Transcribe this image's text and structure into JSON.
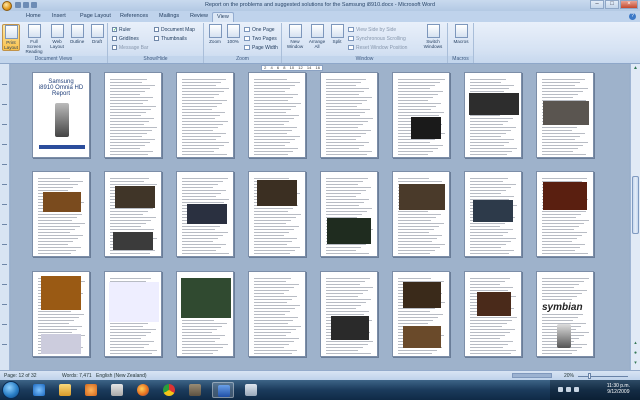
{
  "window": {
    "title": "Report on the problems and suggested solutions for the Samsung i8910.docx - Microsoft Word"
  },
  "tabs": [
    "Home",
    "Insert",
    "Page Layout",
    "References",
    "Mailings",
    "Review",
    "View"
  ],
  "active_tab": "View",
  "ribbon": {
    "document_views": {
      "label": "Document Views",
      "buttons": [
        "Print Layout",
        "Full Screen Reading",
        "Web Layout",
        "Outline",
        "Draft"
      ]
    },
    "show_hide": {
      "label": "Show/Hide",
      "checks": [
        {
          "label": "Ruler",
          "checked": true
        },
        {
          "label": "Gridlines",
          "checked": false
        },
        {
          "label": "Message Bar",
          "checked": false
        },
        {
          "label": "Document Map",
          "checked": false
        },
        {
          "label": "Thumbnails",
          "checked": false
        }
      ]
    },
    "zoom": {
      "label": "Zoom",
      "buttons": [
        "Zoom",
        "100%"
      ],
      "small": [
        "One Page",
        "Two Pages",
        "Page Width"
      ]
    },
    "window": {
      "label": "Window",
      "buttons": [
        "New Window",
        "Arrange All",
        "Split"
      ],
      "small": [
        "View Side by Side",
        "Synchronous Scrolling",
        "Reset Window Position"
      ],
      "switch": "Switch Windows"
    },
    "macros": {
      "label": "Macros",
      "button": "Macros"
    }
  },
  "ruler_numbers": [
    "2",
    "4",
    "6",
    "8",
    "10",
    "12",
    "14",
    "16"
  ],
  "pages": {
    "cover_title_lines": [
      "Samsung",
      "i8910 Omnia HD",
      "Report"
    ],
    "symbian_logo": "symbian"
  },
  "status": {
    "page": "Page: 12 of 32",
    "words": "Words: 7,471",
    "language": "English (New Zealand)",
    "zoom": "20%"
  },
  "taskbar": {
    "time": "11:30 p.m.",
    "date": "9/12/2009"
  }
}
